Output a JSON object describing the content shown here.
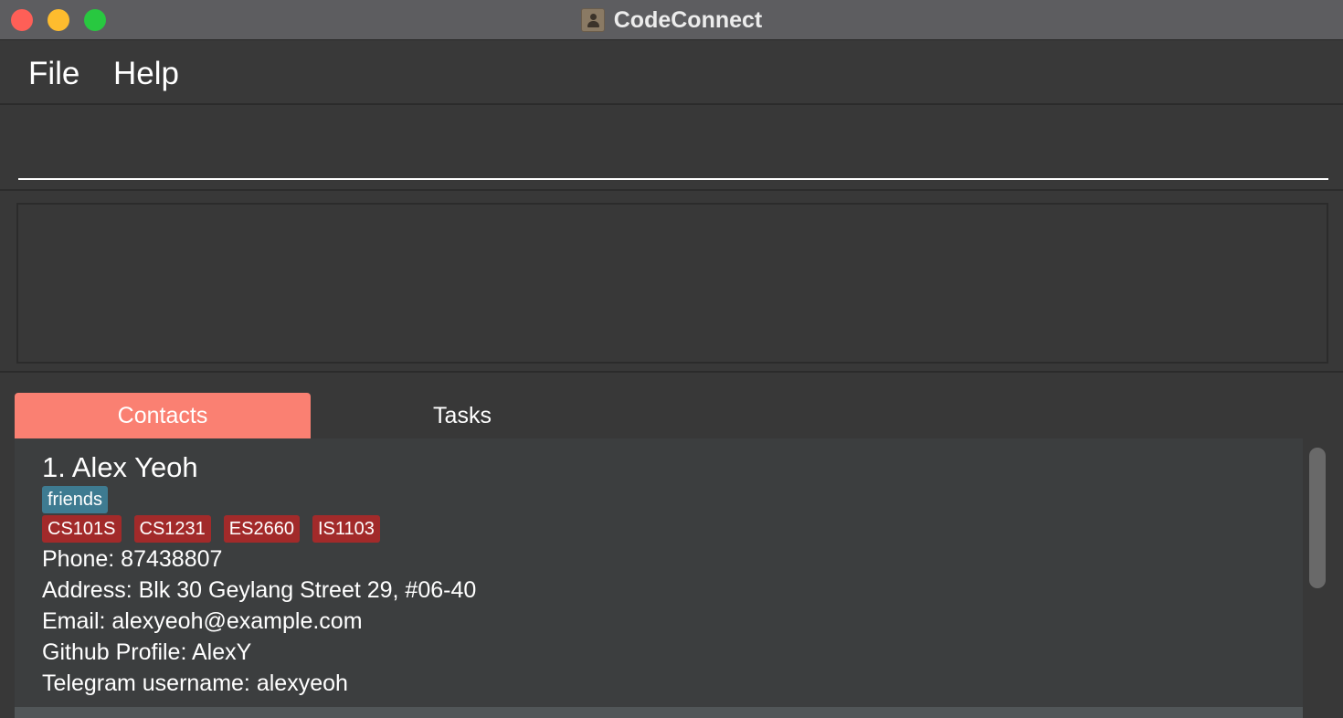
{
  "window": {
    "title": "CodeConnect",
    "icon": "contact-book-icon"
  },
  "menu": {
    "file": "File",
    "help": "Help"
  },
  "command": {
    "value": "",
    "placeholder": ""
  },
  "result": {
    "text": ""
  },
  "tabs": {
    "contacts": "Contacts",
    "tasks": "Tasks",
    "active": "Contacts"
  },
  "contacts": [
    {
      "index_name": "1.  Alex Yeoh",
      "role_tags": [
        "friends"
      ],
      "module_tags": [
        "CS101S",
        "CS1231",
        "ES2660",
        "IS1103"
      ],
      "phone": "Phone: 87438807",
      "address": "Address: Blk 30 Geylang Street 29, #06-40",
      "email": "Email: alexyeoh@example.com",
      "github": "Github Profile: AlexY",
      "telegram": "Telegram username: alexyeoh"
    }
  ],
  "colors": {
    "active_tab": "#fa8072",
    "friend_tag": "#3e7b91",
    "module_tag": "#a22a2a",
    "background": "#383838",
    "card": "#3c3e3f"
  }
}
